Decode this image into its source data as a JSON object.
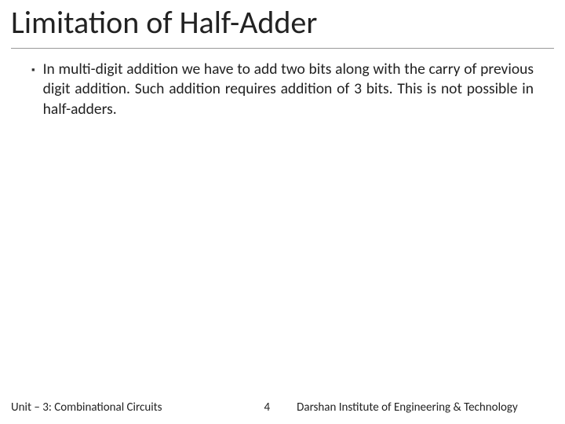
{
  "title": "Limitation of Half-Adder",
  "bullets": [
    "In multi-digit addition we have to add two bits along with the carry of previous digit addition. Such addition requires addition of 3 bits. This is not possible in half-adders."
  ],
  "footer": {
    "left": "Unit – 3: Combinational Circuits",
    "page": "4",
    "right": "Darshan Institute of Engineering & Technology"
  }
}
